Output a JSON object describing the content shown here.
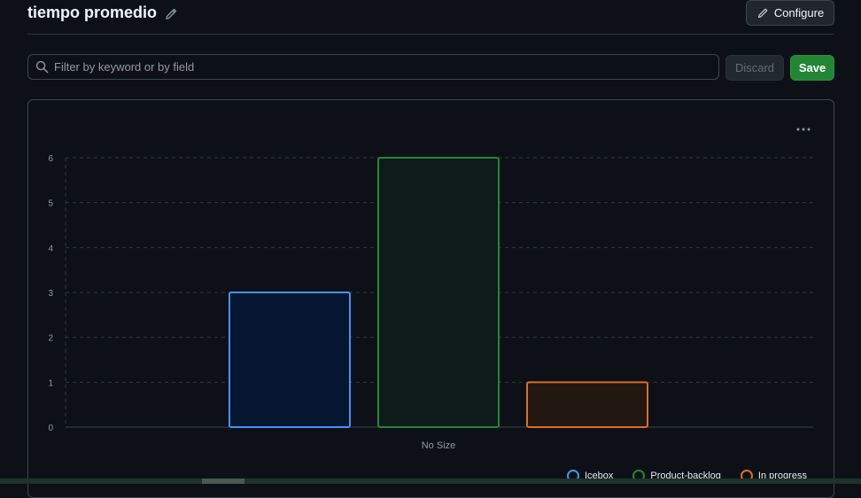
{
  "header": {
    "title": "tiempo promedio",
    "configure_label": "Configure"
  },
  "filter": {
    "placeholder": "Filter by keyword or by field",
    "value": ""
  },
  "actions": {
    "discard_label": "Discard",
    "save_label": "Save"
  },
  "icons": {
    "edit": "pencil-icon",
    "search": "search-icon",
    "more": "kebab-horizontal-icon"
  },
  "colors": {
    "accent_green": "#238636",
    "icebox": "#4493f8",
    "product_backlog": "#238636",
    "in_progress": "#db6d28"
  },
  "chart_data": {
    "type": "bar",
    "categories": [
      "No Size"
    ],
    "series": [
      {
        "name": "Icebox",
        "values": [
          3
        ],
        "color": "#4493f8",
        "fill": "#051630"
      },
      {
        "name": "Product-backlog",
        "values": [
          6
        ],
        "color": "#238636",
        "fill": "#0f1b19"
      },
      {
        "name": "In progress",
        "values": [
          1
        ],
        "color": "#db6d28",
        "fill": "#221711"
      }
    ],
    "yticks": [
      "0",
      "1",
      "2",
      "3",
      "4",
      "5",
      "6"
    ],
    "ylim": [
      0,
      6
    ],
    "grid": true,
    "legend_position": "bottom-right"
  }
}
